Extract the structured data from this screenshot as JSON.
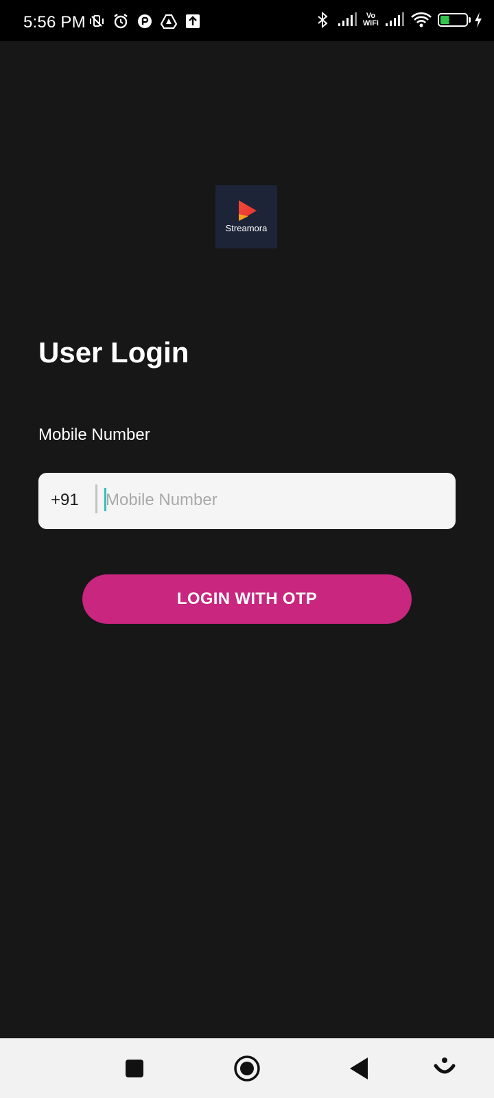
{
  "status_bar": {
    "time": "5:56 PM",
    "icons_left": [
      "mute-vibrate-icon",
      "alarm-icon",
      "messenger-icon",
      "drive-icon",
      "upload-icon"
    ],
    "icons_right": [
      "bluetooth-icon",
      "signal-icon",
      "vowifi-icon",
      "signal-icon",
      "wifi-icon",
      "battery-icon",
      "charging-icon"
    ],
    "vowifi_top": "Vo",
    "vowifi_bottom": "WiFi",
    "battery_level": "33",
    "battery_percent": 33
  },
  "logo": {
    "name": "Streamora"
  },
  "login": {
    "title": "User Login",
    "field_label": "Mobile Number",
    "country_code": "+91",
    "input_placeholder": "Mobile Number",
    "input_value": "",
    "button_label": "LOGIN WITH OTP"
  },
  "colors": {
    "background": "#171717",
    "button": "#c8267f",
    "logo_bg": "#1e2438",
    "caret": "#2cc2b8"
  },
  "nav_bar": {
    "items": [
      "recent-apps-icon",
      "home-icon",
      "back-icon",
      "assistant-icon"
    ]
  }
}
